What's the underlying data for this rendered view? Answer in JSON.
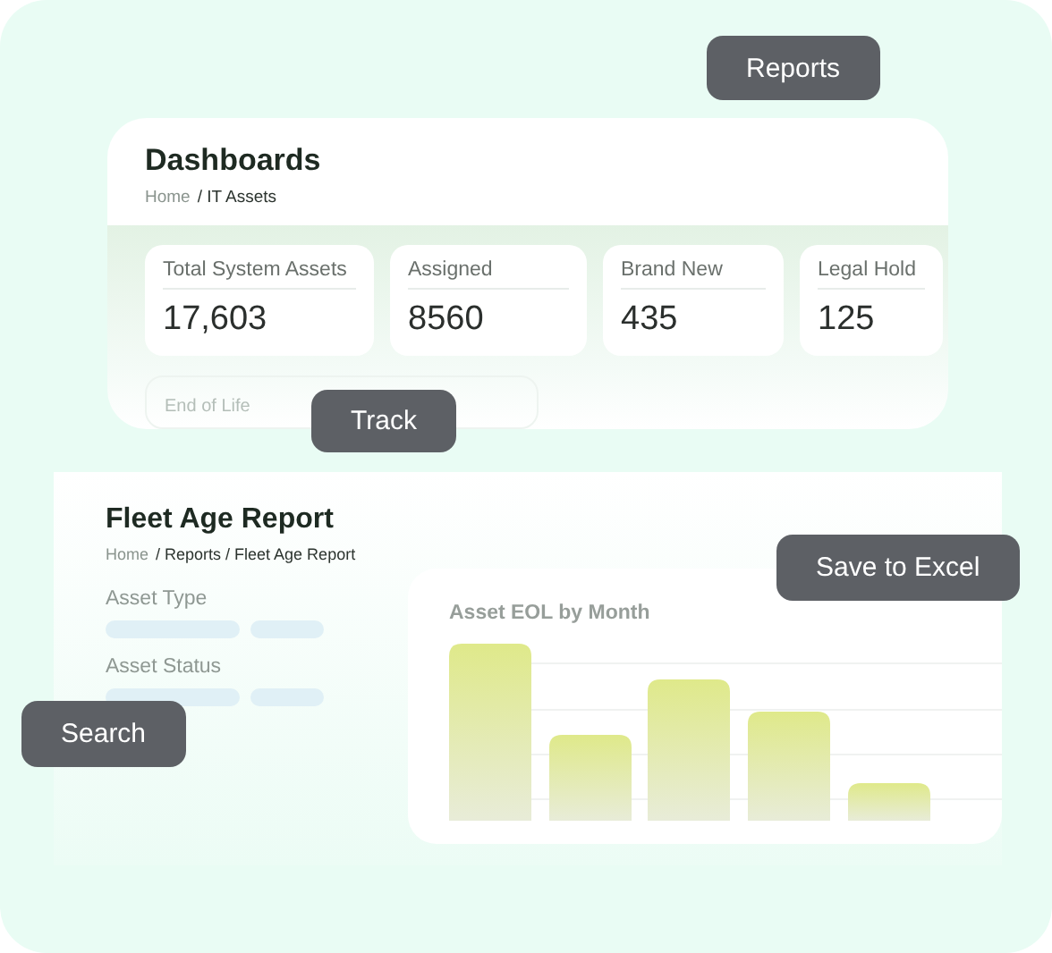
{
  "tags": [
    {
      "kind": "reports",
      "label": "Reports"
    },
    {
      "kind": "track",
      "label": "Track"
    },
    {
      "kind": "excel",
      "label": "Save to Excel"
    },
    {
      "kind": "search",
      "label": "Search"
    }
  ],
  "dashboard": {
    "title": "Dashboards",
    "breadcrumb": [
      "Home",
      "/ IT Assets"
    ],
    "stats": [
      {
        "label": "Total System Assets",
        "value": "17,603"
      },
      {
        "label": "Assigned",
        "value": "8560"
      },
      {
        "label": "Brand New",
        "value": "435"
      },
      {
        "label": "Legal Hold",
        "value": "125"
      }
    ],
    "faded_stats": [
      "End of Life"
    ]
  },
  "report": {
    "title": "Fleet Age Report",
    "breadcrumb": [
      "Home",
      "/ Reports / Fleet Age Report"
    ],
    "filters": [
      "Asset Type",
      "Asset Status"
    ],
    "chart_title": "Asset EOL by Month"
  }
}
